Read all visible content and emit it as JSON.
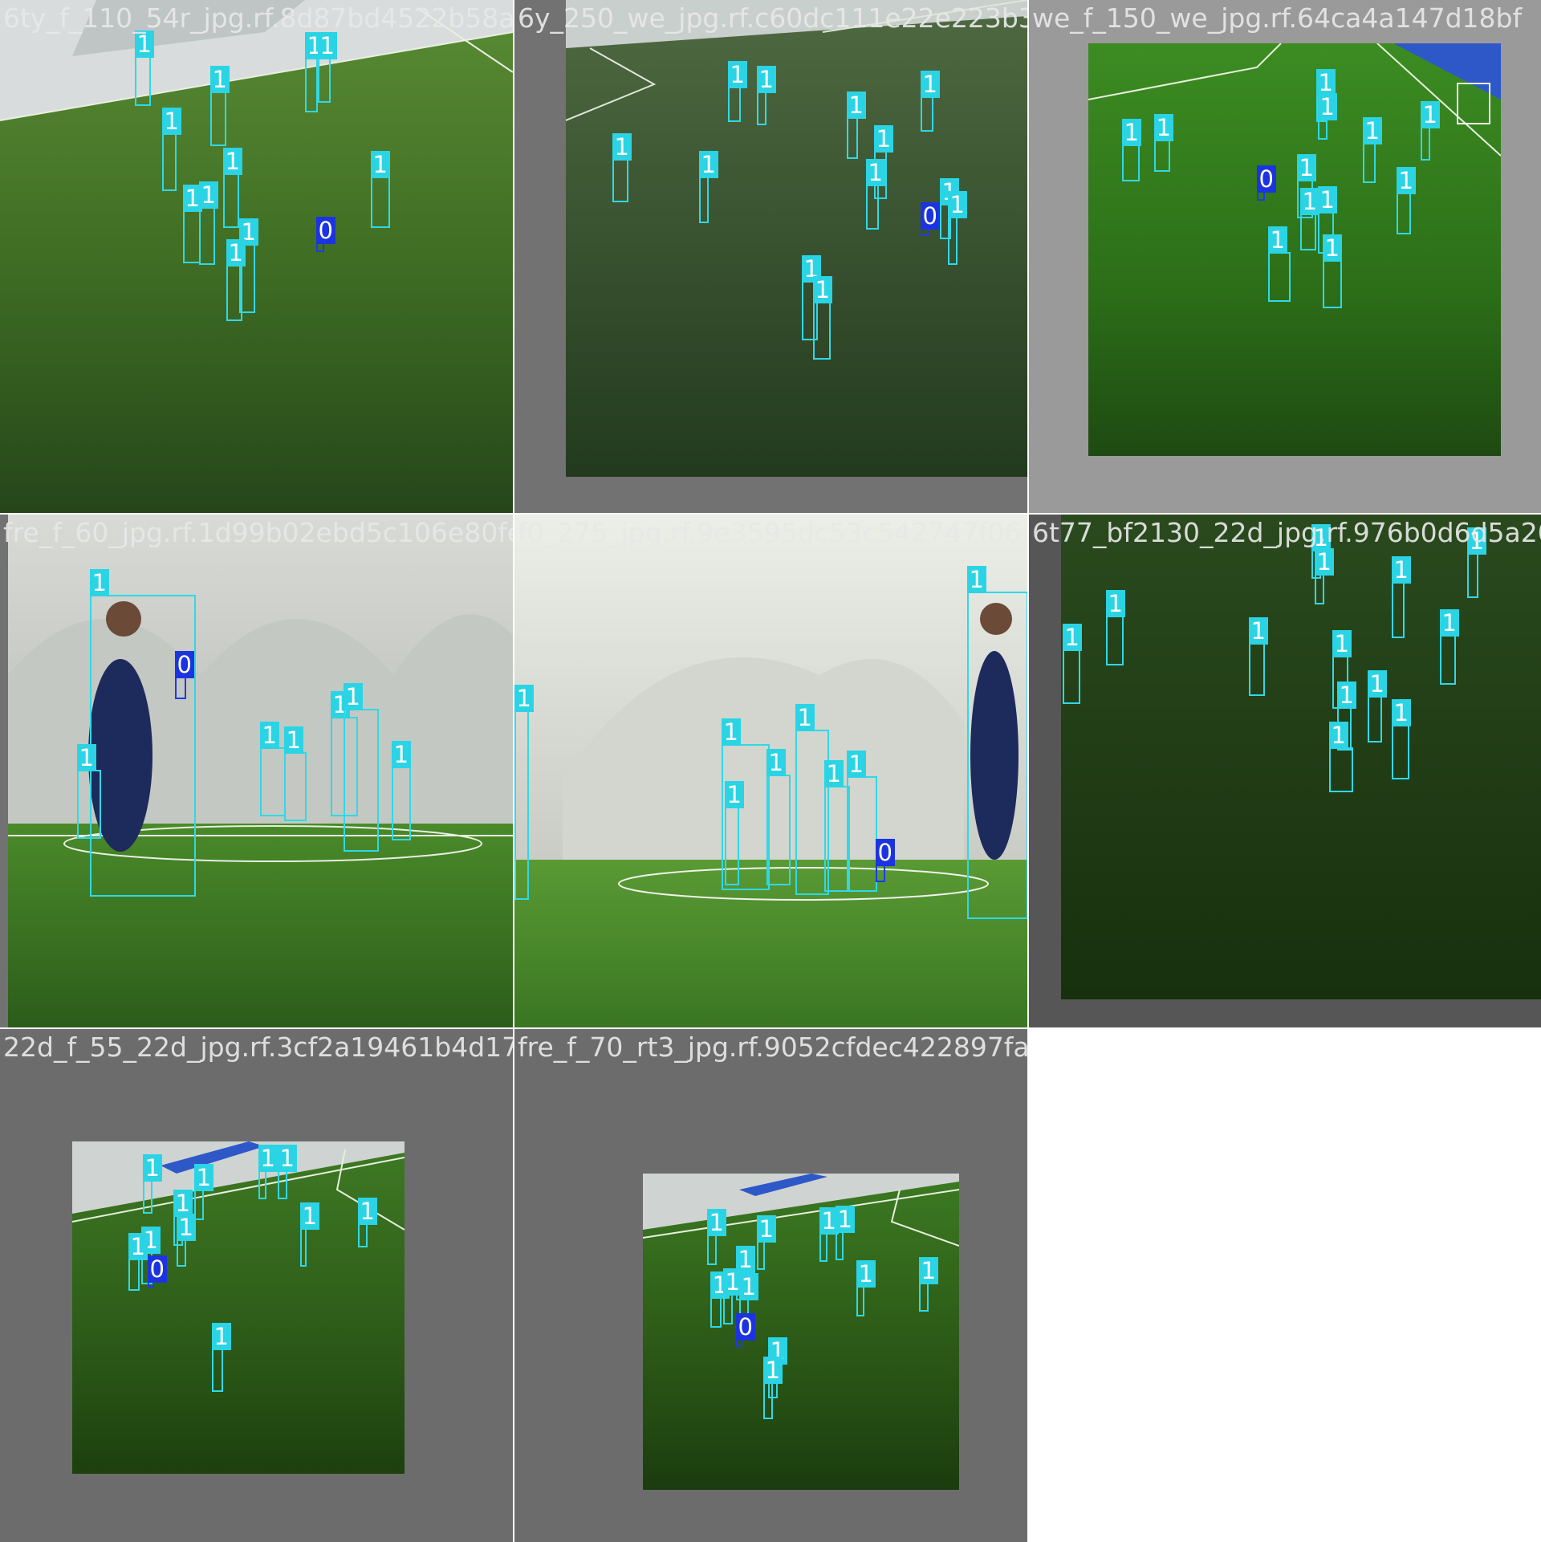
{
  "title": "",
  "colors": {
    "class_1_box": "#30d8e8",
    "class_0_box": "#1c3ce6",
    "grey_pad": "#727272",
    "turf_light": "#4c8a2a",
    "turf_dark": "#1f3a12",
    "dome_white": "#e6e8e6"
  },
  "tiles": [
    {
      "id": "t1",
      "filename": "6ty_f_110_54r_jpg.rf.8d87bd4522b58a4632",
      "scene": "aerial-turf",
      "boxes": [
        {
          "label": "1"
        },
        {
          "label": "1"
        },
        {
          "label": "1"
        },
        {
          "label": "1"
        },
        {
          "label": "1"
        },
        {
          "label": "1"
        },
        {
          "label": "1"
        },
        {
          "label": "1"
        },
        {
          "label": "1"
        },
        {
          "label": "1"
        },
        {
          "label": "1"
        },
        {
          "label": "1"
        },
        {
          "label": "0"
        }
      ]
    },
    {
      "id": "t2",
      "filename": "6y_250_we_jpg.rf.c60dc111e22e223b3c193",
      "scene": "aerial-turf-padded",
      "boxes": [
        {
          "label": "1"
        },
        {
          "label": "1"
        },
        {
          "label": "1"
        },
        {
          "label": "1"
        },
        {
          "label": "1"
        },
        {
          "label": "1"
        },
        {
          "label": "1"
        },
        {
          "label": "1"
        },
        {
          "label": "1"
        },
        {
          "label": "1"
        },
        {
          "label": "1"
        },
        {
          "label": "1"
        },
        {
          "label": "0"
        }
      ]
    },
    {
      "id": "t3",
      "filename": "we_f_150_we_jpg.rf.64ca4a147d18bf",
      "scene": "aerial-turf-padded",
      "boxes": [
        {
          "label": "1"
        },
        {
          "label": "1"
        },
        {
          "label": "1"
        },
        {
          "label": "1"
        },
        {
          "label": "1"
        },
        {
          "label": "1"
        },
        {
          "label": "1"
        },
        {
          "label": "1"
        },
        {
          "label": "1"
        },
        {
          "label": "1"
        },
        {
          "label": "1"
        },
        {
          "label": "1"
        },
        {
          "label": "1"
        },
        {
          "label": "0"
        }
      ]
    },
    {
      "id": "t4",
      "filename": "fre_f_60_jpg.rf.1d99b02ebd5c106e80fe22",
      "scene": "ground-dome",
      "boxes": [
        {
          "label": "1"
        },
        {
          "label": "1"
        },
        {
          "label": "1"
        },
        {
          "label": "1"
        },
        {
          "label": "1"
        },
        {
          "label": "1"
        },
        {
          "label": "1"
        },
        {
          "label": "0"
        }
      ]
    },
    {
      "id": "t5",
      "filename": "f0_275_jpg.rf.9e3595dc53c542747f06",
      "scene": "ground-dome",
      "boxes": [
        {
          "label": "1"
        },
        {
          "label": "1"
        },
        {
          "label": "1"
        },
        {
          "label": "1"
        },
        {
          "label": "1"
        },
        {
          "label": "1"
        },
        {
          "label": "1"
        },
        {
          "label": "1"
        },
        {
          "label": "1"
        },
        {
          "label": "0"
        }
      ]
    },
    {
      "id": "t6",
      "filename": "6t77_bf2130_22d_jpg.rf.976b0d6d5a207",
      "scene": "aerial-dark-padded",
      "boxes": [
        {
          "label": "1"
        },
        {
          "label": "1"
        },
        {
          "label": "1"
        },
        {
          "label": "1"
        },
        {
          "label": "1"
        },
        {
          "label": "1"
        },
        {
          "label": "1"
        },
        {
          "label": "1"
        },
        {
          "label": "1"
        },
        {
          "label": "1"
        },
        {
          "label": "1"
        },
        {
          "label": "1"
        },
        {
          "label": "1"
        },
        {
          "label": "1"
        }
      ]
    },
    {
      "id": "t7",
      "filename": "22d_f_55_22d_jpg.rf.3cf2a19461b4d176b",
      "scene": "aerial-small",
      "boxes": [
        {
          "label": "1"
        },
        {
          "label": "1"
        },
        {
          "label": "1"
        },
        {
          "label": "1"
        },
        {
          "label": "1"
        },
        {
          "label": "1"
        },
        {
          "label": "1"
        },
        {
          "label": "1"
        },
        {
          "label": "1"
        },
        {
          "label": "1"
        },
        {
          "label": "1"
        },
        {
          "label": "1"
        },
        {
          "label": "0"
        }
      ]
    },
    {
      "id": "t8",
      "filename": "fre_f_70_rt3_jpg.rf.9052cfdec422897fa82e",
      "scene": "aerial-small",
      "boxes": [
        {
          "label": "1"
        },
        {
          "label": "1"
        },
        {
          "label": "1"
        },
        {
          "label": "1"
        },
        {
          "label": "1"
        },
        {
          "label": "1"
        },
        {
          "label": "1"
        },
        {
          "label": "1"
        },
        {
          "label": "1"
        },
        {
          "label": "1"
        },
        {
          "label": "1"
        },
        {
          "label": "1"
        },
        {
          "label": "1"
        },
        {
          "label": "0"
        }
      ]
    }
  ]
}
